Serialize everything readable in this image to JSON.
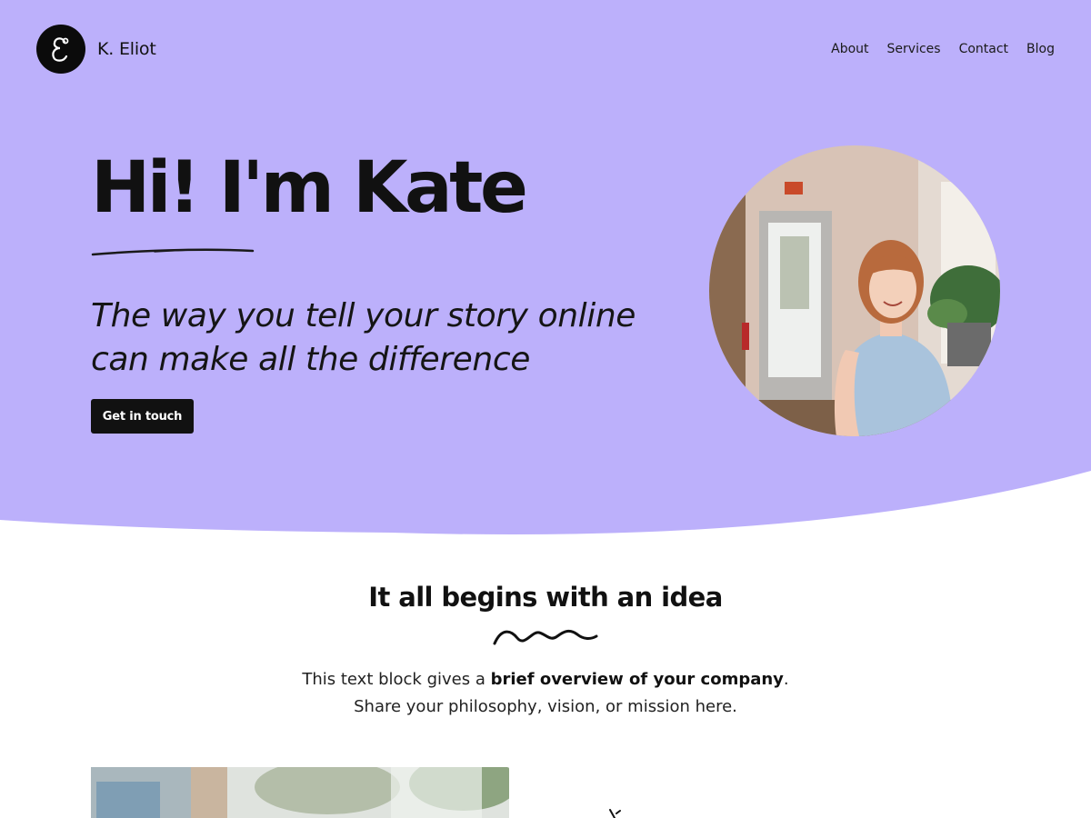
{
  "header": {
    "brand_name": "K. Eliot",
    "logo_icon": "script-e-logo-icon",
    "nav": [
      {
        "label": "About"
      },
      {
        "label": "Services"
      },
      {
        "label": "Contact"
      },
      {
        "label": "Blog"
      }
    ]
  },
  "hero": {
    "title": "Hi! I'm Kate",
    "tagline_line1": "The way you tell your story online",
    "tagline_line2": "can make all the difference",
    "cta_label": "Get in touch",
    "portrait_alt": "portrait-photo"
  },
  "intro": {
    "title": "It all begins with an idea",
    "text_prefix": "This text block gives a ",
    "text_bold": "brief overview of your company",
    "text_suffix": ".",
    "text_line2": "Share your philosophy, vision, or mission here."
  },
  "colors": {
    "hero_background": "#bcb0fb",
    "button_background": "#111111",
    "text": "#111111"
  }
}
